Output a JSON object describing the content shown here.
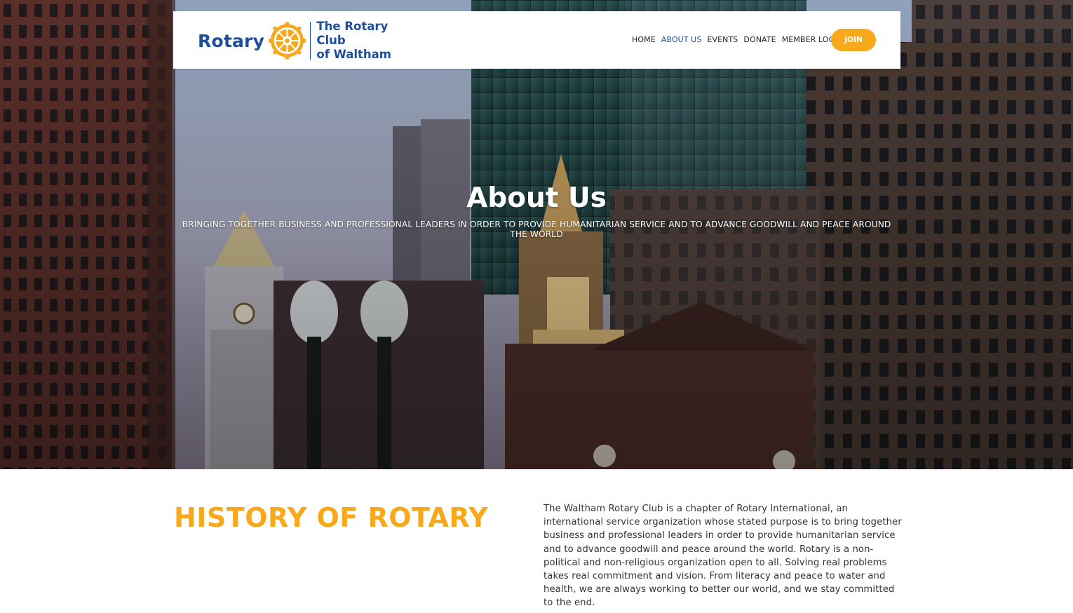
{
  "logo": {
    "wordmark": "Rotary",
    "club_line1": "The Rotary Club",
    "club_line2": "of Waltham",
    "brand_blue": "#1f4e9b",
    "brand_gold": "#f7a81b",
    "icon": "rotary-wheel-icon"
  },
  "nav": {
    "items": [
      {
        "label": "HOME",
        "active": false
      },
      {
        "label": "ABOUT US",
        "active": true
      },
      {
        "label": "EVENTS",
        "active": false
      },
      {
        "label": "DONATE",
        "active": false
      },
      {
        "label": "MEMBER LOGIN",
        "active": false
      }
    ],
    "join_label": "JOIN"
  },
  "hero": {
    "title": "About Us",
    "subtitle": "BRINGING TOGETHER BUSINESS AND PROFESSIONAL LEADERS IN ORDER TO PROVIDE HUMANITARIAN SERVICE AND TO ADVANCE GOODWILL AND PEACE AROUND THE WORLD"
  },
  "history": {
    "heading": "HISTORY OF ROTARY",
    "body": "The Waltham Rotary Club is a chapter of Rotary International, an international service organization whose stated purpose is to bring together business and professional leaders in order to provide humanitarian service and to advance goodwill and peace around the world. Rotary is a non-political and non-religious organization open to all. Solving real problems takes real commitment and vision. From literacy and peace to water and health, we are always working to better our world, and we stay committed to the end."
  }
}
